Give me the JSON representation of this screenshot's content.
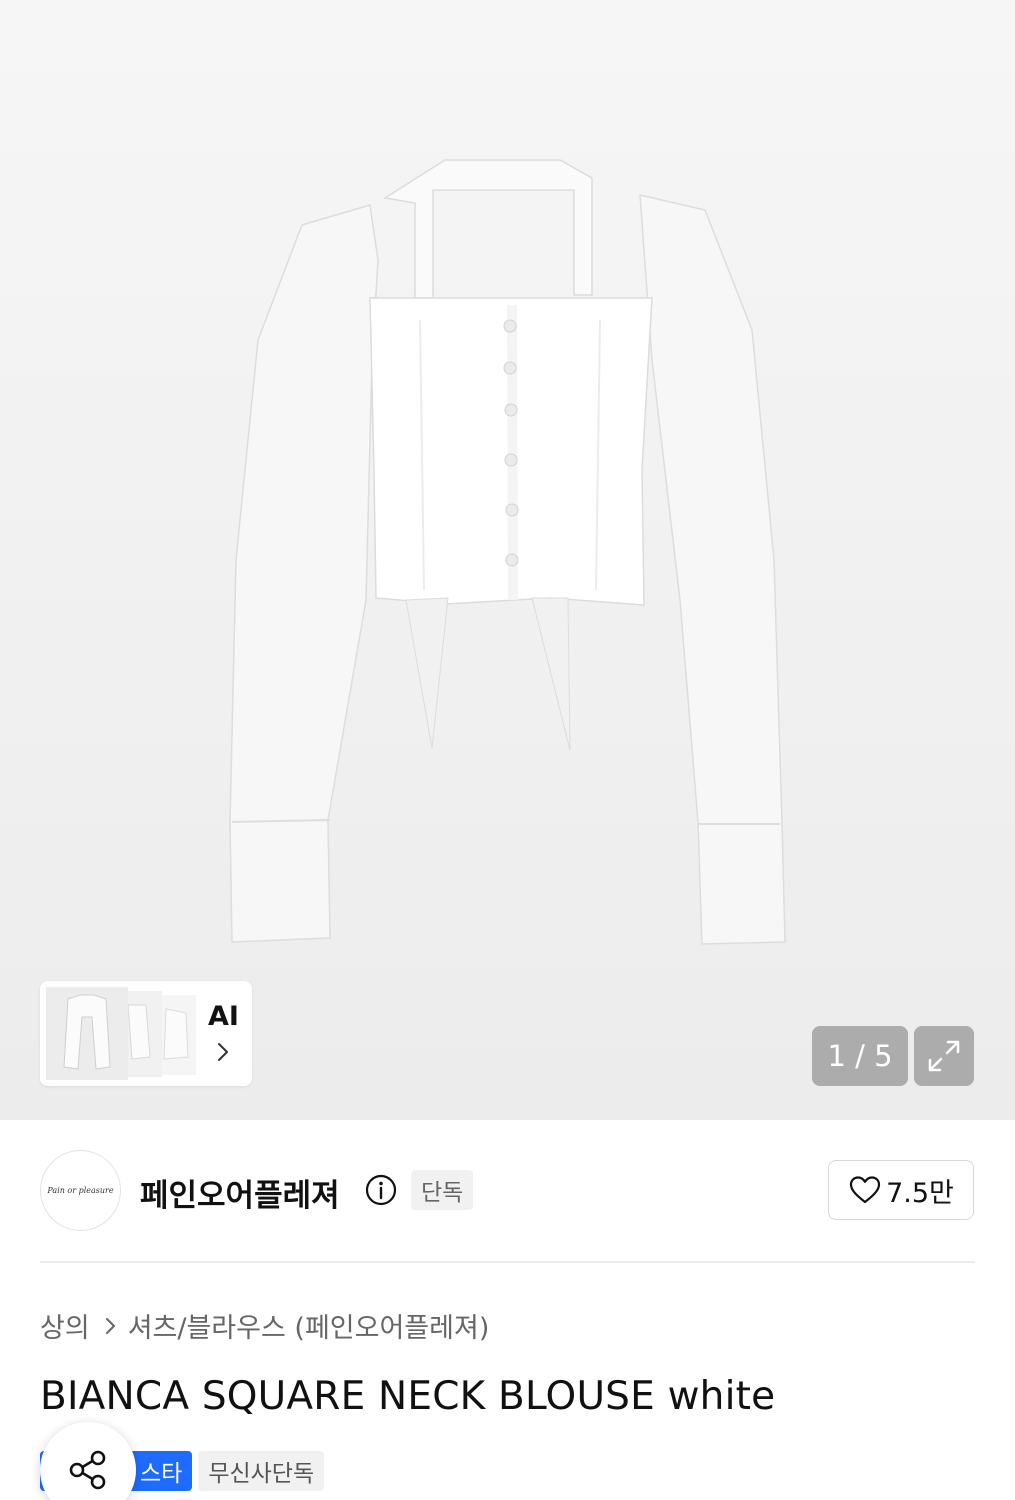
{
  "gallery": {
    "image_alt": "BIANCA SQUARE NECK BLOUSE white",
    "ai_label": "AI",
    "page_indicator": "1 / 5"
  },
  "brand": {
    "logo_text": "Pain or pleasure",
    "name": "페인오어플레져",
    "exclusive_tag": "단독",
    "like_count": "7.5만"
  },
  "breadcrumb": {
    "category": "상의",
    "subcategory": "셔츠/블라우스 (페인오어플레져)"
  },
  "product": {
    "title": "BIANCA SQUARE NECK BLOUSE white",
    "badges": {
      "blue": "스타",
      "gray": "무신사단독"
    }
  },
  "colors": {
    "accent_blue": "#1e6bff",
    "hero_background": "#efefef",
    "text_primary": "#111111",
    "text_secondary": "#666666"
  }
}
